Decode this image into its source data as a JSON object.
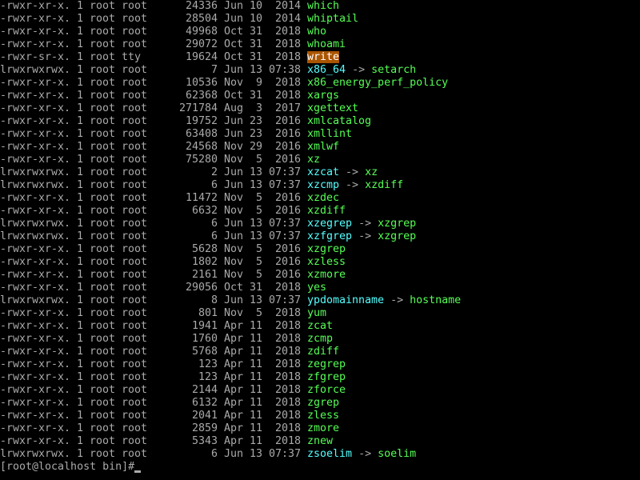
{
  "colors": {
    "background": "#000000",
    "text": "#aaaaaa",
    "executable": "#55ff55",
    "symlink": "#55ffff",
    "suid_bg": "#aa5500",
    "suid_fg": "#ffffff"
  },
  "listing": [
    {
      "perms": "-rwxr-xr-x.",
      "links": "1",
      "owner": "root",
      "group": "root",
      "size": "24336",
      "month": "Jun",
      "day": "10",
      "time": "2014",
      "name": "which",
      "kind": "exec",
      "target": ""
    },
    {
      "perms": "-rwxr-xr-x.",
      "links": "1",
      "owner": "root",
      "group": "root",
      "size": "28504",
      "month": "Jun",
      "day": "10",
      "time": "2014",
      "name": "whiptail",
      "kind": "exec",
      "target": ""
    },
    {
      "perms": "-rwxr-xr-x.",
      "links": "1",
      "owner": "root",
      "group": "root",
      "size": "49968",
      "month": "Oct",
      "day": "31",
      "time": "2018",
      "name": "who",
      "kind": "exec",
      "target": ""
    },
    {
      "perms": "-rwxr-xr-x.",
      "links": "1",
      "owner": "root",
      "group": "root",
      "size": "29072",
      "month": "Oct",
      "day": "31",
      "time": "2018",
      "name": "whoami",
      "kind": "exec",
      "target": ""
    },
    {
      "perms": "-rwxr-sr-x.",
      "links": "1",
      "owner": "root",
      "group": "tty",
      "size": "19624",
      "month": "Oct",
      "day": "31",
      "time": "2018",
      "name": "write",
      "kind": "suid",
      "target": ""
    },
    {
      "perms": "lrwxrwxrwx.",
      "links": "1",
      "owner": "root",
      "group": "root",
      "size": "7",
      "month": "Jun",
      "day": "13",
      "time": "07:38",
      "name": "x86_64",
      "kind": "link",
      "target": "setarch"
    },
    {
      "perms": "-rwxr-xr-x.",
      "links": "1",
      "owner": "root",
      "group": "root",
      "size": "10536",
      "month": "Nov",
      "day": "9",
      "time": "2018",
      "name": "x86_energy_perf_policy",
      "kind": "exec",
      "target": ""
    },
    {
      "perms": "-rwxr-xr-x.",
      "links": "1",
      "owner": "root",
      "group": "root",
      "size": "62368",
      "month": "Oct",
      "day": "31",
      "time": "2018",
      "name": "xargs",
      "kind": "exec",
      "target": ""
    },
    {
      "perms": "-rwxr-xr-x.",
      "links": "1",
      "owner": "root",
      "group": "root",
      "size": "271784",
      "month": "Aug",
      "day": "3",
      "time": "2017",
      "name": "xgettext",
      "kind": "exec",
      "target": ""
    },
    {
      "perms": "-rwxr-xr-x.",
      "links": "1",
      "owner": "root",
      "group": "root",
      "size": "19752",
      "month": "Jun",
      "day": "23",
      "time": "2016",
      "name": "xmlcatalog",
      "kind": "exec",
      "target": ""
    },
    {
      "perms": "-rwxr-xr-x.",
      "links": "1",
      "owner": "root",
      "group": "root",
      "size": "63408",
      "month": "Jun",
      "day": "23",
      "time": "2016",
      "name": "xmllint",
      "kind": "exec",
      "target": ""
    },
    {
      "perms": "-rwxr-xr-x.",
      "links": "1",
      "owner": "root",
      "group": "root",
      "size": "24568",
      "month": "Nov",
      "day": "29",
      "time": "2016",
      "name": "xmlwf",
      "kind": "exec",
      "target": ""
    },
    {
      "perms": "-rwxr-xr-x.",
      "links": "1",
      "owner": "root",
      "group": "root",
      "size": "75280",
      "month": "Nov",
      "day": "5",
      "time": "2016",
      "name": "xz",
      "kind": "exec",
      "target": ""
    },
    {
      "perms": "lrwxrwxrwx.",
      "links": "1",
      "owner": "root",
      "group": "root",
      "size": "2",
      "month": "Jun",
      "day": "13",
      "time": "07:37",
      "name": "xzcat",
      "kind": "link",
      "target": "xz"
    },
    {
      "perms": "lrwxrwxrwx.",
      "links": "1",
      "owner": "root",
      "group": "root",
      "size": "6",
      "month": "Jun",
      "day": "13",
      "time": "07:37",
      "name": "xzcmp",
      "kind": "link",
      "target": "xzdiff"
    },
    {
      "perms": "-rwxr-xr-x.",
      "links": "1",
      "owner": "root",
      "group": "root",
      "size": "11472",
      "month": "Nov",
      "day": "5",
      "time": "2016",
      "name": "xzdec",
      "kind": "exec",
      "target": ""
    },
    {
      "perms": "-rwxr-xr-x.",
      "links": "1",
      "owner": "root",
      "group": "root",
      "size": "6632",
      "month": "Nov",
      "day": "5",
      "time": "2016",
      "name": "xzdiff",
      "kind": "exec",
      "target": ""
    },
    {
      "perms": "lrwxrwxrwx.",
      "links": "1",
      "owner": "root",
      "group": "root",
      "size": "6",
      "month": "Jun",
      "day": "13",
      "time": "07:37",
      "name": "xzegrep",
      "kind": "link",
      "target": "xzgrep"
    },
    {
      "perms": "lrwxrwxrwx.",
      "links": "1",
      "owner": "root",
      "group": "root",
      "size": "6",
      "month": "Jun",
      "day": "13",
      "time": "07:37",
      "name": "xzfgrep",
      "kind": "link",
      "target": "xzgrep"
    },
    {
      "perms": "-rwxr-xr-x.",
      "links": "1",
      "owner": "root",
      "group": "root",
      "size": "5628",
      "month": "Nov",
      "day": "5",
      "time": "2016",
      "name": "xzgrep",
      "kind": "exec",
      "target": ""
    },
    {
      "perms": "-rwxr-xr-x.",
      "links": "1",
      "owner": "root",
      "group": "root",
      "size": "1802",
      "month": "Nov",
      "day": "5",
      "time": "2016",
      "name": "xzless",
      "kind": "exec",
      "target": ""
    },
    {
      "perms": "-rwxr-xr-x.",
      "links": "1",
      "owner": "root",
      "group": "root",
      "size": "2161",
      "month": "Nov",
      "day": "5",
      "time": "2016",
      "name": "xzmore",
      "kind": "exec",
      "target": ""
    },
    {
      "perms": "-rwxr-xr-x.",
      "links": "1",
      "owner": "root",
      "group": "root",
      "size": "29056",
      "month": "Oct",
      "day": "31",
      "time": "2018",
      "name": "yes",
      "kind": "exec",
      "target": ""
    },
    {
      "perms": "lrwxrwxrwx.",
      "links": "1",
      "owner": "root",
      "group": "root",
      "size": "8",
      "month": "Jun",
      "day": "13",
      "time": "07:37",
      "name": "ypdomainname",
      "kind": "link",
      "target": "hostname"
    },
    {
      "perms": "-rwxr-xr-x.",
      "links": "1",
      "owner": "root",
      "group": "root",
      "size": "801",
      "month": "Nov",
      "day": "5",
      "time": "2018",
      "name": "yum",
      "kind": "exec",
      "target": ""
    },
    {
      "perms": "-rwxr-xr-x.",
      "links": "1",
      "owner": "root",
      "group": "root",
      "size": "1941",
      "month": "Apr",
      "day": "11",
      "time": "2018",
      "name": "zcat",
      "kind": "exec",
      "target": ""
    },
    {
      "perms": "-rwxr-xr-x.",
      "links": "1",
      "owner": "root",
      "group": "root",
      "size": "1760",
      "month": "Apr",
      "day": "11",
      "time": "2018",
      "name": "zcmp",
      "kind": "exec",
      "target": ""
    },
    {
      "perms": "-rwxr-xr-x.",
      "links": "1",
      "owner": "root",
      "group": "root",
      "size": "5768",
      "month": "Apr",
      "day": "11",
      "time": "2018",
      "name": "zdiff",
      "kind": "exec",
      "target": ""
    },
    {
      "perms": "-rwxr-xr-x.",
      "links": "1",
      "owner": "root",
      "group": "root",
      "size": "123",
      "month": "Apr",
      "day": "11",
      "time": "2018",
      "name": "zegrep",
      "kind": "exec",
      "target": ""
    },
    {
      "perms": "-rwxr-xr-x.",
      "links": "1",
      "owner": "root",
      "group": "root",
      "size": "123",
      "month": "Apr",
      "day": "11",
      "time": "2018",
      "name": "zfgrep",
      "kind": "exec",
      "target": ""
    },
    {
      "perms": "-rwxr-xr-x.",
      "links": "1",
      "owner": "root",
      "group": "root",
      "size": "2144",
      "month": "Apr",
      "day": "11",
      "time": "2018",
      "name": "zforce",
      "kind": "exec",
      "target": ""
    },
    {
      "perms": "-rwxr-xr-x.",
      "links": "1",
      "owner": "root",
      "group": "root",
      "size": "6132",
      "month": "Apr",
      "day": "11",
      "time": "2018",
      "name": "zgrep",
      "kind": "exec",
      "target": ""
    },
    {
      "perms": "-rwxr-xr-x.",
      "links": "1",
      "owner": "root",
      "group": "root",
      "size": "2041",
      "month": "Apr",
      "day": "11",
      "time": "2018",
      "name": "zless",
      "kind": "exec",
      "target": ""
    },
    {
      "perms": "-rwxr-xr-x.",
      "links": "1",
      "owner": "root",
      "group": "root",
      "size": "2859",
      "month": "Apr",
      "day": "11",
      "time": "2018",
      "name": "zmore",
      "kind": "exec",
      "target": ""
    },
    {
      "perms": "-rwxr-xr-x.",
      "links": "1",
      "owner": "root",
      "group": "root",
      "size": "5343",
      "month": "Apr",
      "day": "11",
      "time": "2018",
      "name": "znew",
      "kind": "exec",
      "target": ""
    },
    {
      "perms": "lrwxrwxrwx.",
      "links": "1",
      "owner": "root",
      "group": "root",
      "size": "6",
      "month": "Jun",
      "day": "13",
      "time": "07:37",
      "name": "zsoelim",
      "kind": "link",
      "target": "soelim"
    }
  ],
  "arrow": "->",
  "prompt": {
    "text": "[root@localhost bin]#"
  }
}
